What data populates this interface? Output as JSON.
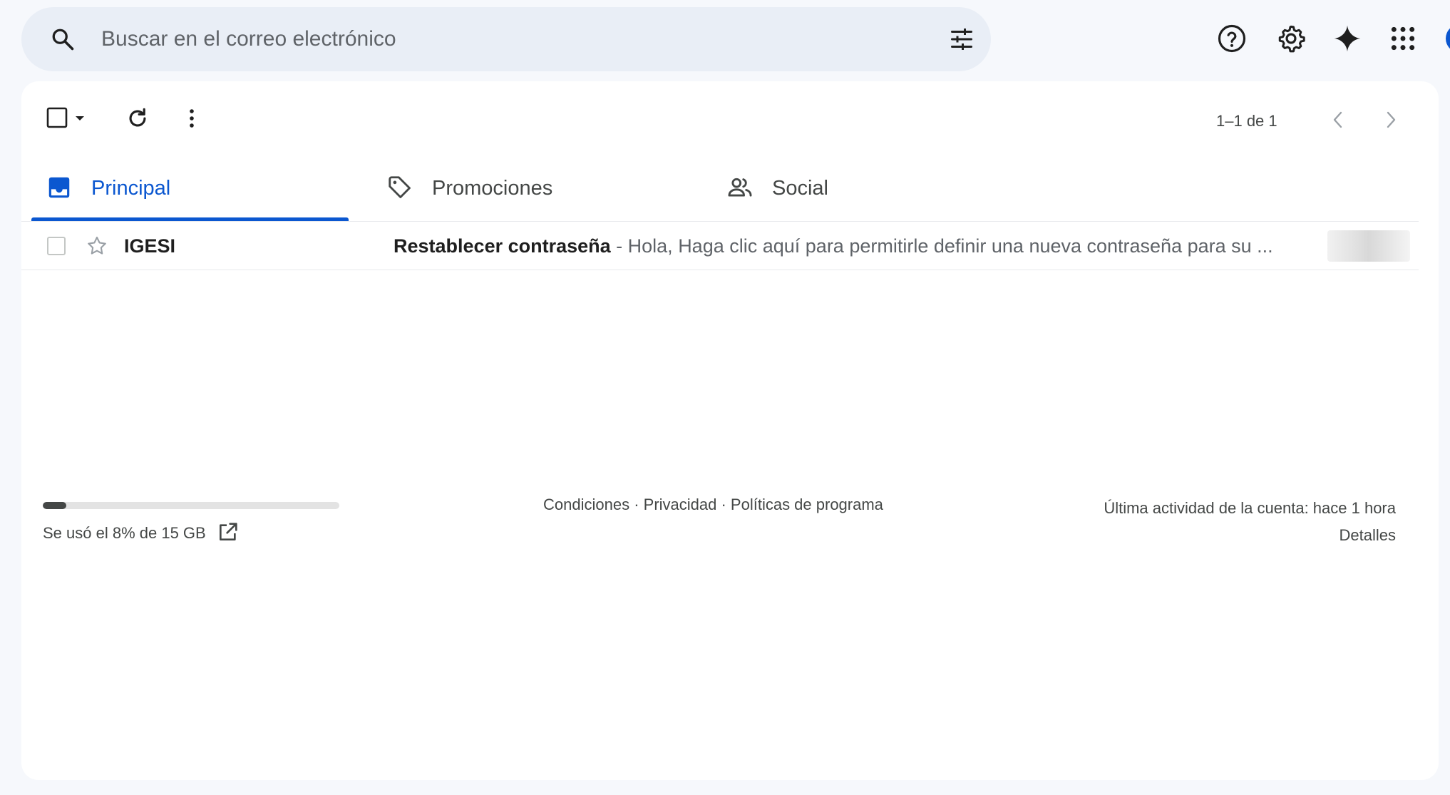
{
  "search": {
    "placeholder": "Buscar en el correo electrónico"
  },
  "header_icons": [
    "help-icon",
    "settings-icon",
    "gemini-spark-icon",
    "apps-grid-icon"
  ],
  "toolbar": {
    "pagination": "1–1 de 1"
  },
  "tabs": [
    {
      "label": "Principal",
      "icon": "inbox-icon",
      "active": true
    },
    {
      "label": "Promociones",
      "icon": "tag-icon",
      "active": false
    },
    {
      "label": "Social",
      "icon": "people-icon",
      "active": false
    }
  ],
  "messages": [
    {
      "sender": "IGESI",
      "subject": "Restablecer contraseña",
      "separator": " - ",
      "snippet": "Hola, Haga clic aquí para permitirle definir una nueva contraseña para su ...",
      "starred": false,
      "selected": false
    }
  ],
  "footer": {
    "storage": {
      "used_fraction": 0.08,
      "text": "Se usó el 8% de 15 GB"
    },
    "links": [
      "Condiciones",
      "Privacidad",
      "Políticas de programa"
    ],
    "link_separator": " · ",
    "last_activity": "Última actividad de la cuenta: hace 1 hora",
    "details_label": "Detalles"
  },
  "colors": {
    "accent": "#0b57d0",
    "page_background": "#f6f8fc",
    "search_background": "#e9eef6",
    "text_primary": "#1f1f1f",
    "text_secondary": "#444746"
  }
}
